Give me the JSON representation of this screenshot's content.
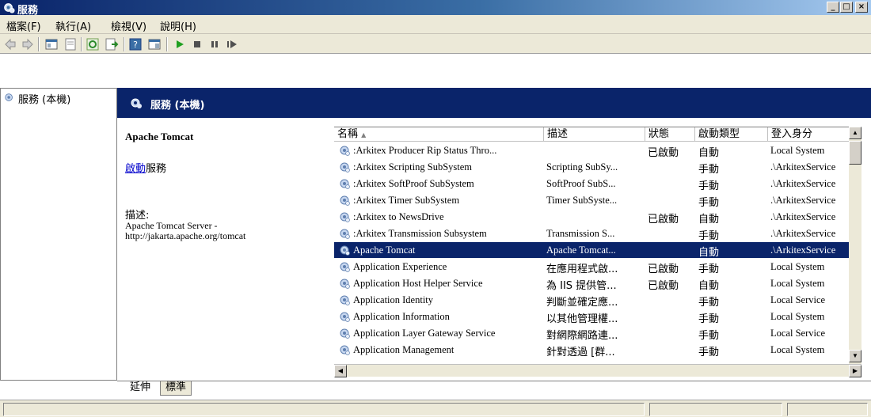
{
  "window": {
    "title": "服務"
  },
  "menu": [
    "檔案(F)",
    "執行(A)",
    "檢視(V)",
    "說明(H)"
  ],
  "tree": {
    "item": "服務 (本機)"
  },
  "header": {
    "title": "服務 (本機)"
  },
  "detail": {
    "service_name": "Apache Tomcat",
    "start_link": "啟動",
    "start_suffix": "服務",
    "desc_label": "描述:",
    "description": "Apache Tomcat Server - http://jakarta.apache.org/tomcat"
  },
  "columns": [
    "名稱",
    "描述",
    "狀態",
    "啟動類型",
    "登入身分"
  ],
  "services": [
    {
      "name": ":Arkitex Producer Rip Status Thro...",
      "desc": "",
      "status": "已啟動",
      "startup": "自動",
      "logon": "Local System"
    },
    {
      "name": ":Arkitex Scripting SubSystem",
      "desc": "Scripting SubSy...",
      "status": "",
      "startup": "手動",
      "logon": ".\\ArkitexService"
    },
    {
      "name": ":Arkitex SoftProof SubSystem",
      "desc": "SoftProof SubS...",
      "status": "",
      "startup": "手動",
      "logon": ".\\ArkitexService"
    },
    {
      "name": ":Arkitex Timer SubSystem",
      "desc": "Timer SubSyste...",
      "status": "",
      "startup": "手動",
      "logon": ".\\ArkitexService"
    },
    {
      "name": ":Arkitex to NewsDrive",
      "desc": "",
      "status": "已啟動",
      "startup": "自動",
      "logon": ".\\ArkitexService"
    },
    {
      "name": ":Arkitex Transmission Subsystem",
      "desc": "Transmission S...",
      "status": "",
      "startup": "手動",
      "logon": ".\\ArkitexService"
    },
    {
      "name": "Apache Tomcat",
      "desc": "Apache Tomcat...",
      "status": "",
      "startup": "自動",
      "logon": ".\\ArkitexService",
      "selected": true
    },
    {
      "name": "Application Experience",
      "desc": "在應用程式啟...",
      "status": "已啟動",
      "startup": "手動",
      "logon": "Local System"
    },
    {
      "name": "Application Host Helper Service",
      "desc": "為 IIS 提供管...",
      "status": "已啟動",
      "startup": "自動",
      "logon": "Local System"
    },
    {
      "name": "Application Identity",
      "desc": "判斷並確定應...",
      "status": "",
      "startup": "手動",
      "logon": "Local Service"
    },
    {
      "name": "Application Information",
      "desc": "以其他管理權...",
      "status": "",
      "startup": "手動",
      "logon": "Local System"
    },
    {
      "name": "Application Layer Gateway Service",
      "desc": "對網際網路連...",
      "status": "",
      "startup": "手動",
      "logon": "Local Service"
    },
    {
      "name": "Application Management",
      "desc": "針對透過 [群...",
      "status": "",
      "startup": "手動",
      "logon": "Local System"
    }
  ],
  "tabs": {
    "extended": "延伸",
    "standard": "標準"
  },
  "colors": {
    "selection": "#0a246a",
    "header_bg": "#0a246a",
    "link": "#0000cc"
  }
}
